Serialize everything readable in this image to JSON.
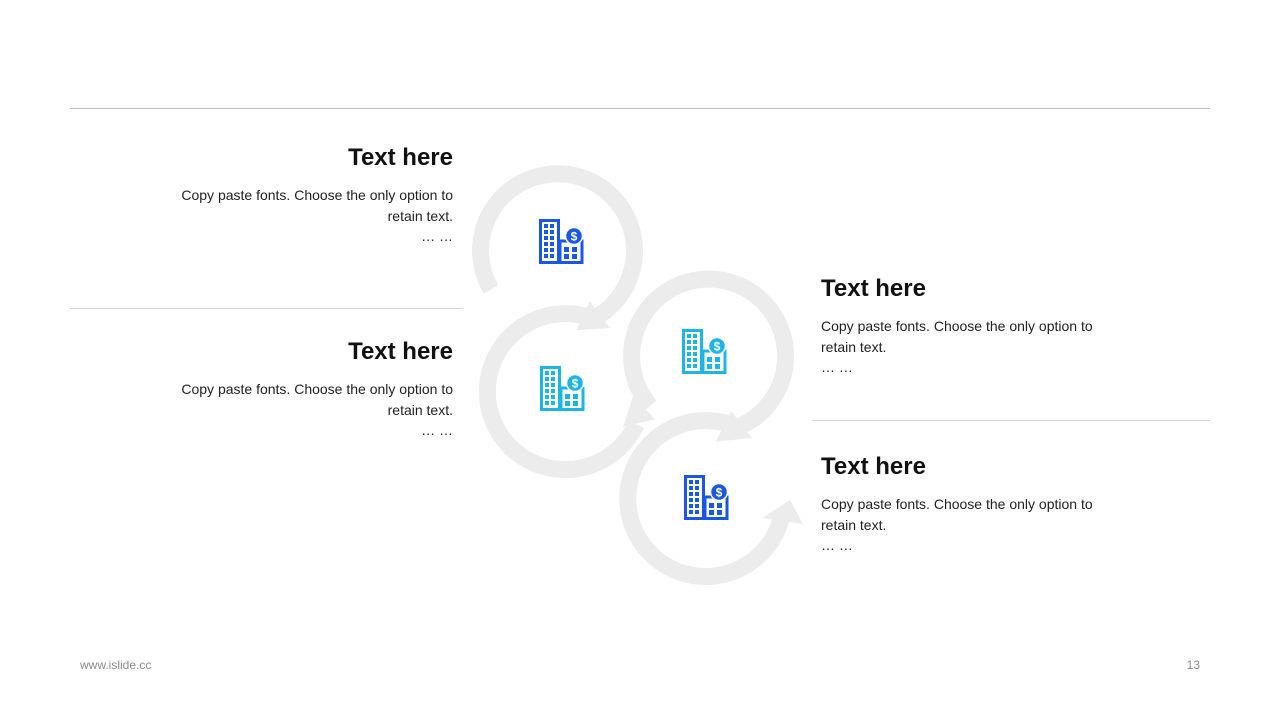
{
  "colors": {
    "ring": "#ececec",
    "icon_dark_blue": "#1a56e8",
    "icon_light_blue": "#1db4ea",
    "rule": "#bdbdbd"
  },
  "items": [
    {
      "title": "Text here",
      "body": "Copy paste fonts. Choose the only option to retain text.",
      "ellipsis": "… …",
      "icon": "building-dollar-icon",
      "icon_color": "dark-blue"
    },
    {
      "title": "Text here",
      "body": "Copy paste fonts. Choose the only option to retain text.",
      "ellipsis": "… …",
      "icon": "building-dollar-icon",
      "icon_color": "light-blue"
    },
    {
      "title": "Text here",
      "body": "Copy paste fonts. Choose the only option to retain text.",
      "ellipsis": "… …",
      "icon": "building-dollar-icon",
      "icon_color": "light-blue"
    },
    {
      "title": "Text here",
      "body": "Copy paste fonts. Choose the only option to retain text.",
      "ellipsis": "… …",
      "icon": "building-dollar-icon",
      "icon_color": "dark-blue"
    }
  ],
  "footer": {
    "url": "www.islide.cc",
    "page_number": "13"
  }
}
